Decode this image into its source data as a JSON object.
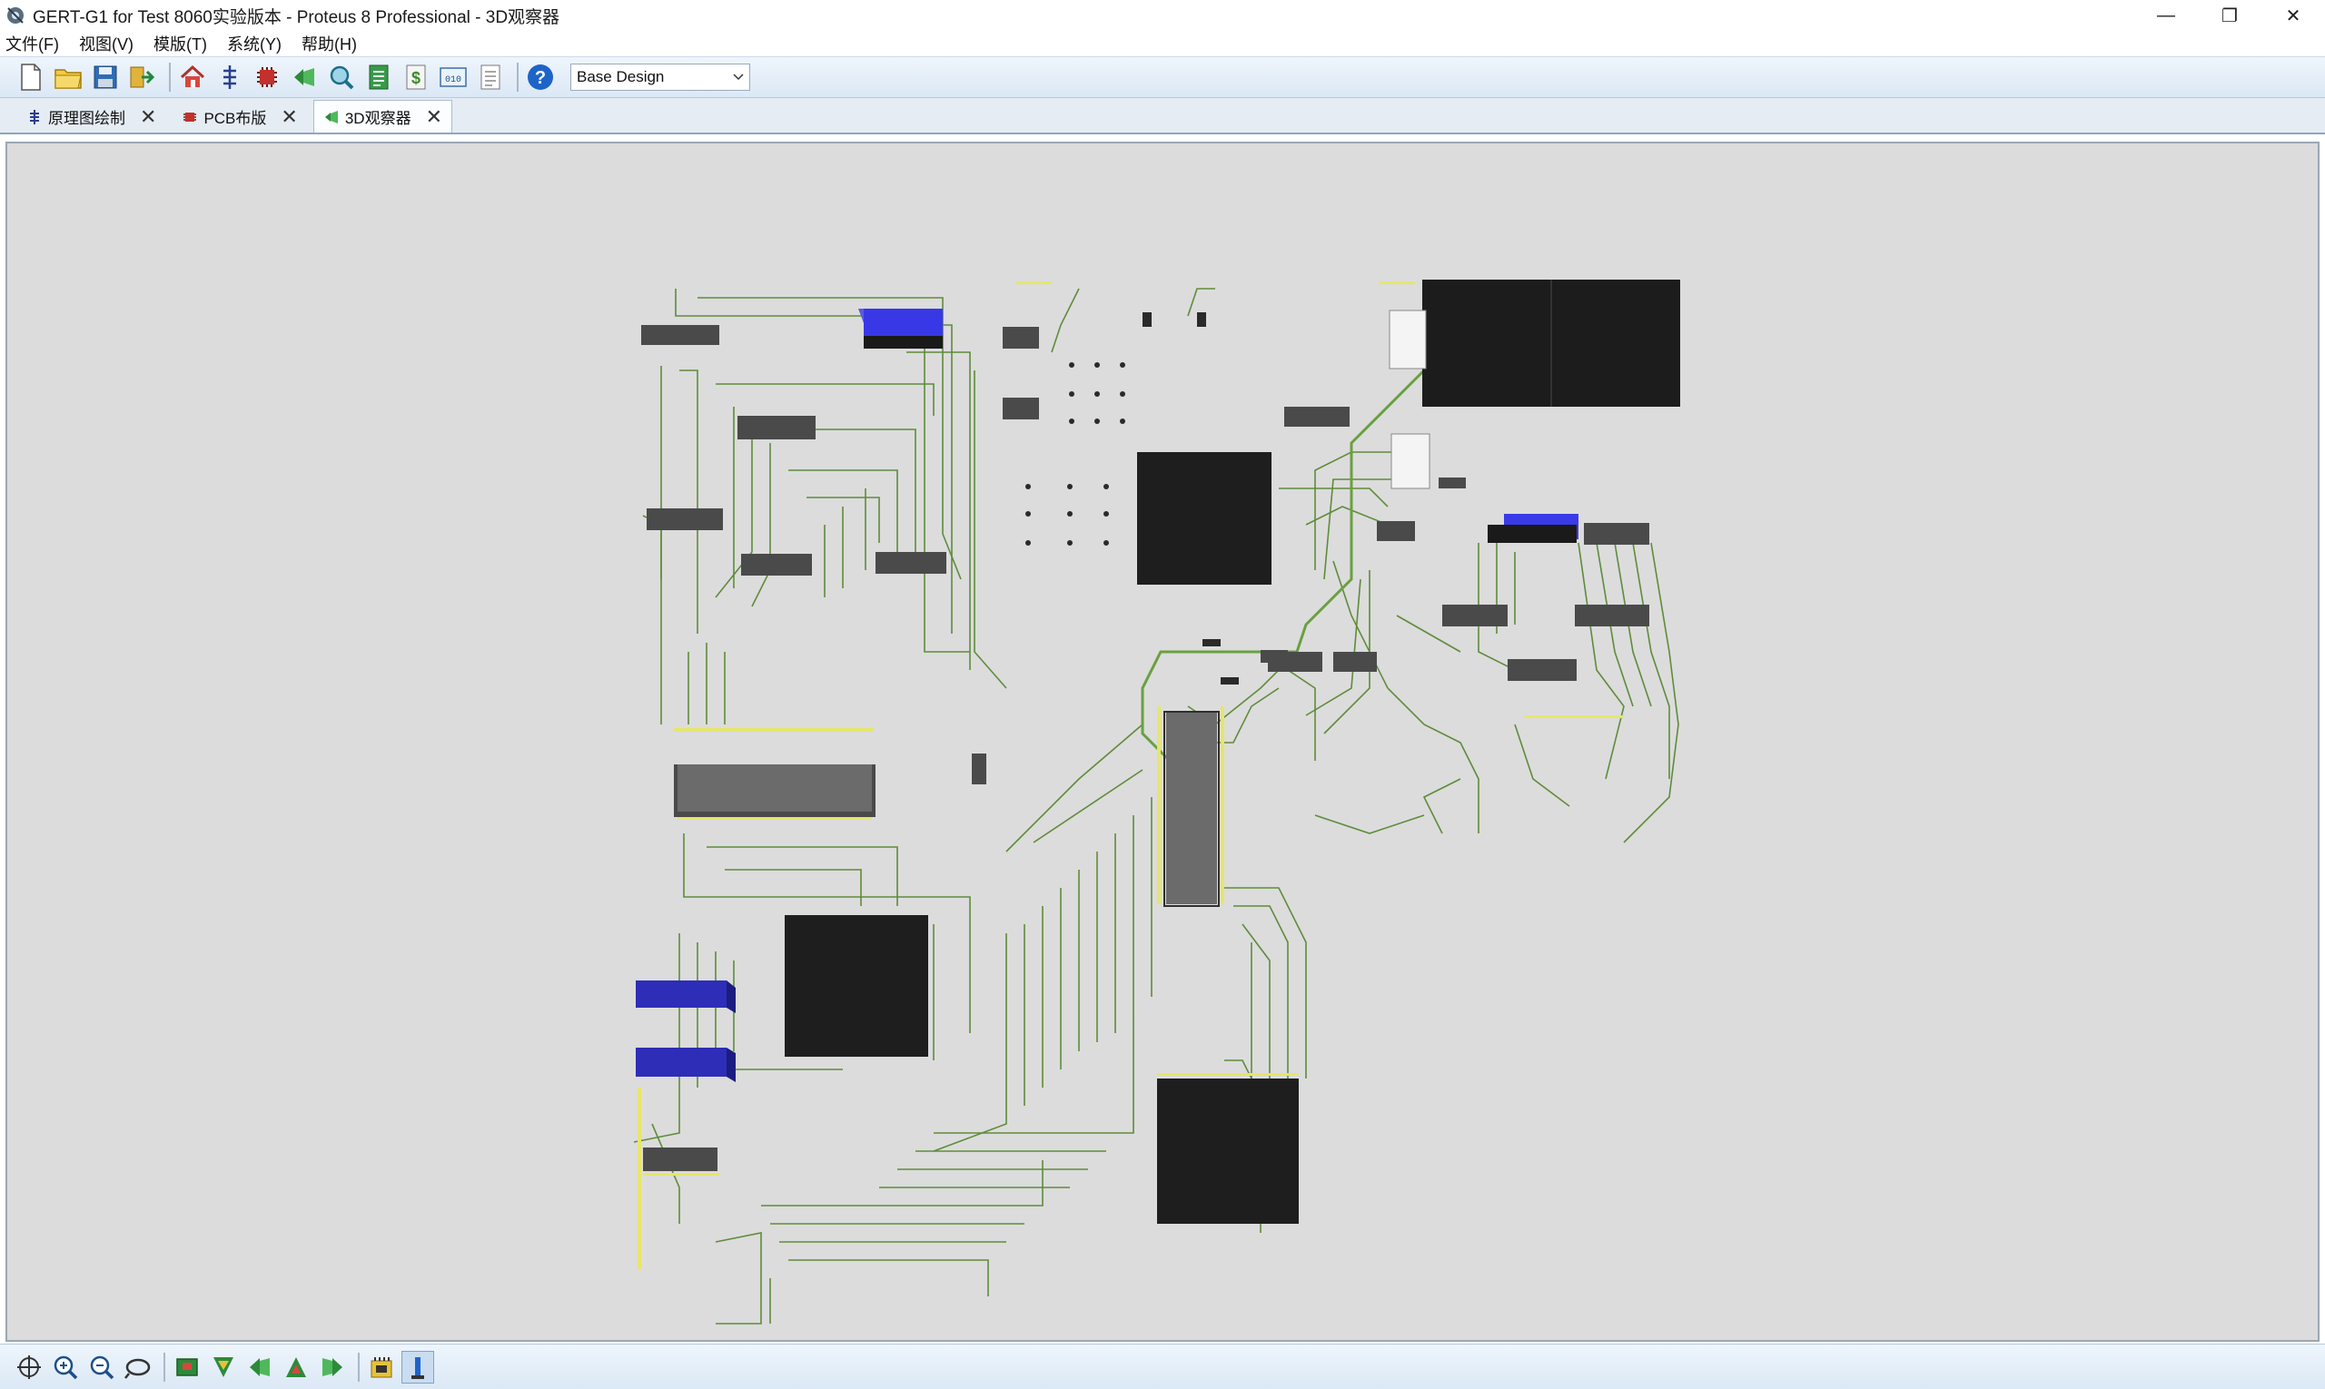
{
  "window": {
    "title": "GERT-G1 for Test 8060实验版本 - Proteus 8 Professional - 3D观察器",
    "controls": {
      "minimize": "—",
      "maximize": "❐",
      "close": "✕"
    }
  },
  "menu": {
    "items": [
      "文件(F)",
      "视图(V)",
      "模版(T)",
      "系统(Y)",
      "帮助(H)"
    ]
  },
  "toolbar": {
    "icons": [
      "new-file-icon",
      "open-folder-icon",
      "save-icon",
      "import-icon",
      "home-icon",
      "schematic-icon",
      "pcb-icon",
      "3d-viewer-icon",
      "gerber-viewer-icon",
      "bom-icon",
      "cost-icon",
      "vsm-studio-icon",
      "notes-icon",
      "help-icon"
    ],
    "design_variant": "Base Design"
  },
  "tabs": [
    {
      "label": "原理图绘制",
      "icon": "schematic-icon",
      "active": false
    },
    {
      "label": "PCB布版",
      "icon": "pcb-icon",
      "active": false
    },
    {
      "label": "3D观察器",
      "icon": "3d-viewer-icon",
      "active": true
    }
  ],
  "bottom_toolbar": {
    "icons": [
      "pan-icon",
      "zoom-in-icon",
      "zoom-out-icon",
      "zoom-fit-icon",
      "top-view-icon",
      "front-view-icon",
      "left-view-icon",
      "back-view-icon",
      "right-view-icon",
      "toggle-components-icon",
      "toggle-board-icon"
    ]
  },
  "colors": {
    "board_bg": "#dcdcdc",
    "trace": "#5e8c3a",
    "chip_dark": "#1e1e1e",
    "chip_grey": "#4a4a4a",
    "connector_blue": "#2d2db8",
    "connector_bright_blue": "#3838e6",
    "pin_yellow": "#e6e66a",
    "white_part": "#f4f4f4"
  }
}
